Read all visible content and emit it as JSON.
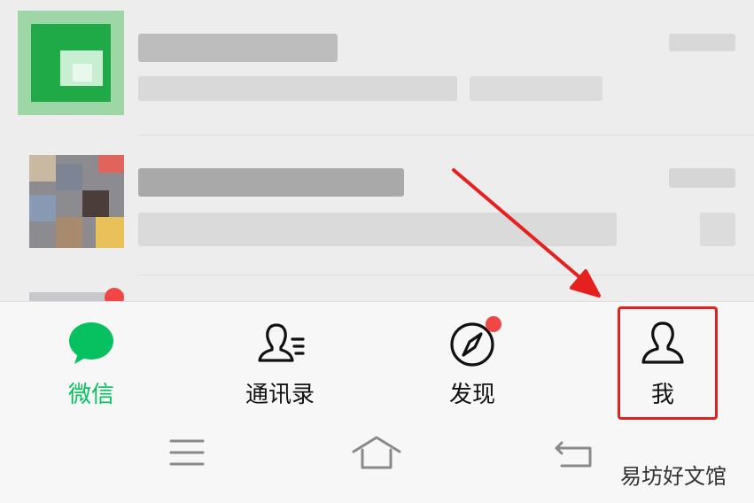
{
  "tabs": [
    {
      "label": "微信",
      "icon": "chat-bubble-icon",
      "active": true
    },
    {
      "label": "通讯录",
      "icon": "contacts-icon",
      "active": false
    },
    {
      "label": "发现",
      "icon": "compass-icon",
      "active": false,
      "badge": "dot"
    },
    {
      "label": "我",
      "icon": "person-icon",
      "active": false
    }
  ],
  "watermark": "易坊好文馆",
  "colors": {
    "accent": "#07c160",
    "badge": "#f04646",
    "annotation": "#e5201f"
  }
}
